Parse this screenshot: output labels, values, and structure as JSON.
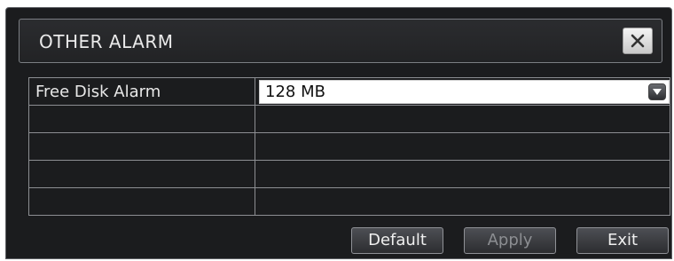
{
  "dialog": {
    "title": "OTHER ALARM",
    "close_icon": "close-icon"
  },
  "settings": {
    "rows": [
      {
        "label": "Free Disk Alarm",
        "value": "128 MB"
      }
    ]
  },
  "buttons": {
    "default_label": "Default",
    "apply_label": "Apply",
    "exit_label": "Exit"
  }
}
